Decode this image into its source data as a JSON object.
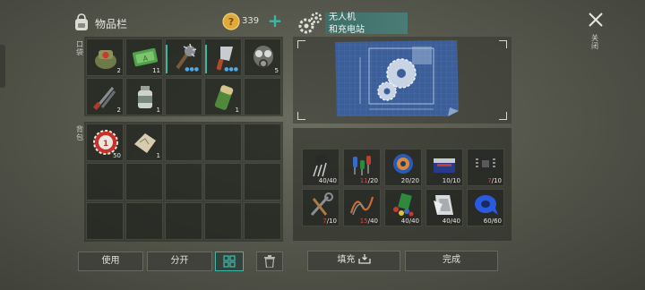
{
  "inventory": {
    "title": "物品栏",
    "coins": "339",
    "pocket_label": "口袋",
    "bag_label": "背包",
    "pocket_slots": [
      {
        "icon": "medkit-bag-icon",
        "qty": "2"
      },
      {
        "icon": "cash-money-icon",
        "qty": "11"
      },
      {
        "icon": "spiked-club-icon",
        "qty": "",
        "dots": "●●●"
      },
      {
        "icon": "cleaver-icon",
        "qty": "",
        "dots": "●●●"
      },
      {
        "icon": "gas-mask-icon",
        "qty": "5"
      },
      {
        "icon": "pliers-icon",
        "qty": "2"
      },
      {
        "icon": "pill-bottle-icon",
        "qty": "1"
      },
      {
        "icon": "empty",
        "qty": ""
      },
      {
        "icon": "battery-icon",
        "qty": "1"
      },
      {
        "icon": "empty",
        "qty": ""
      }
    ],
    "bag_slots": [
      {
        "icon": "bottle-cap-icon",
        "qty": "50"
      },
      {
        "icon": "map-scrap-icon",
        "qty": "1"
      }
    ],
    "buttons": {
      "use": "使用",
      "split": "分开"
    }
  },
  "blueprint": {
    "title_line1": "无人机",
    "title_line2": "和充电站",
    "materials": [
      {
        "icon": "transistor-icon",
        "have": "40",
        "need": "40",
        "short": false
      },
      {
        "icon": "electronic-parts-icon",
        "have": "11",
        "need": "20",
        "short": true
      },
      {
        "icon": "wire-spool-icon",
        "have": "20",
        "need": "20",
        "short": false
      },
      {
        "icon": "battery-pack-icon",
        "have": "10",
        "need": "10",
        "short": false
      },
      {
        "icon": "microchip-icon",
        "have": "7",
        "need": "10",
        "short": true
      },
      {
        "icon": "tools-icon",
        "have": "7",
        "need": "10",
        "short": true
      },
      {
        "icon": "copper-wire-icon",
        "have": "15",
        "need": "40",
        "short": true
      },
      {
        "icon": "color-parts-icon",
        "have": "40",
        "need": "40",
        "short": false
      },
      {
        "icon": "metal-sheet-icon",
        "have": "40",
        "need": "40",
        "short": false
      },
      {
        "icon": "blue-tape-icon",
        "have": "60",
        "need": "60",
        "short": false
      }
    ],
    "buttons": {
      "fill": "填充",
      "done": "完成"
    }
  },
  "close_label": "关闭",
  "colors": {
    "accent": "#3fb6a4",
    "short": "#e0443a",
    "blueprint": "#3c5f9a"
  }
}
